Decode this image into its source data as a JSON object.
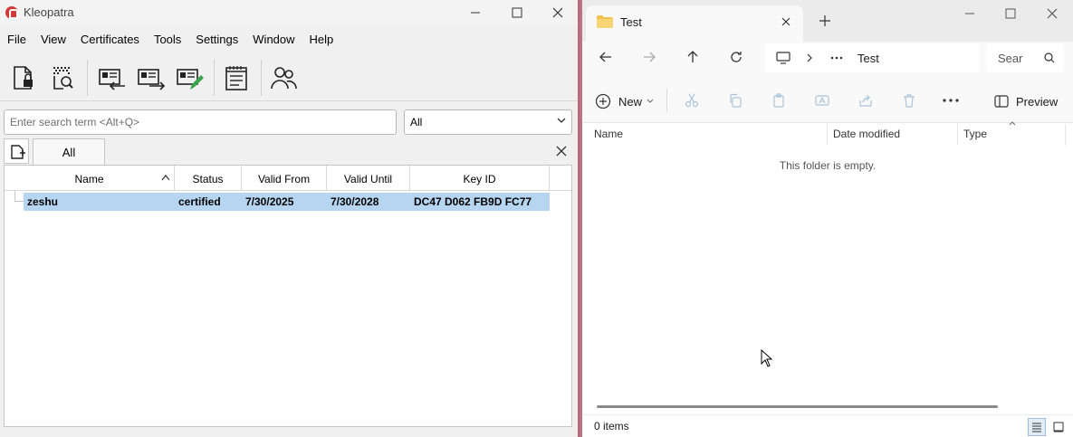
{
  "kleopatra": {
    "title": "Kleopatra",
    "menu": [
      "File",
      "View",
      "Certificates",
      "Tools",
      "Settings",
      "Window",
      "Help"
    ],
    "toolbar_icons": [
      "sign-encrypt-file-icon",
      "decrypt-verify-icon",
      "import-certificate-icon",
      "export-certificate-icon",
      "certify-icon",
      "notepad-icon",
      "groups-icon"
    ],
    "search": {
      "placeholder": "Enter search term <Alt+Q>"
    },
    "filter": {
      "selected": "All"
    },
    "tab": {
      "label": "All"
    },
    "table": {
      "columns": [
        "Name",
        "Status",
        "Valid From",
        "Valid Until",
        "Key ID"
      ],
      "rows": [
        {
          "name": "zeshu",
          "status": "certified",
          "valid_from": "7/30/2025",
          "valid_until": "7/30/2028",
          "key_id": "DC47 D062 FB9D FC77"
        }
      ]
    },
    "accent": "#d23a3a",
    "selection_color": "#b5d5f0"
  },
  "explorer": {
    "tab_title": "Test",
    "address": {
      "current": "Test"
    },
    "search": {
      "placeholder": "Sear"
    },
    "commands": {
      "new": "New",
      "preview": "Preview"
    },
    "columns": [
      "Name",
      "Date modified",
      "Type"
    ],
    "empty_message": "This folder is empty.",
    "status": {
      "count": "0 items"
    },
    "folder_color": "#f2c14e"
  }
}
